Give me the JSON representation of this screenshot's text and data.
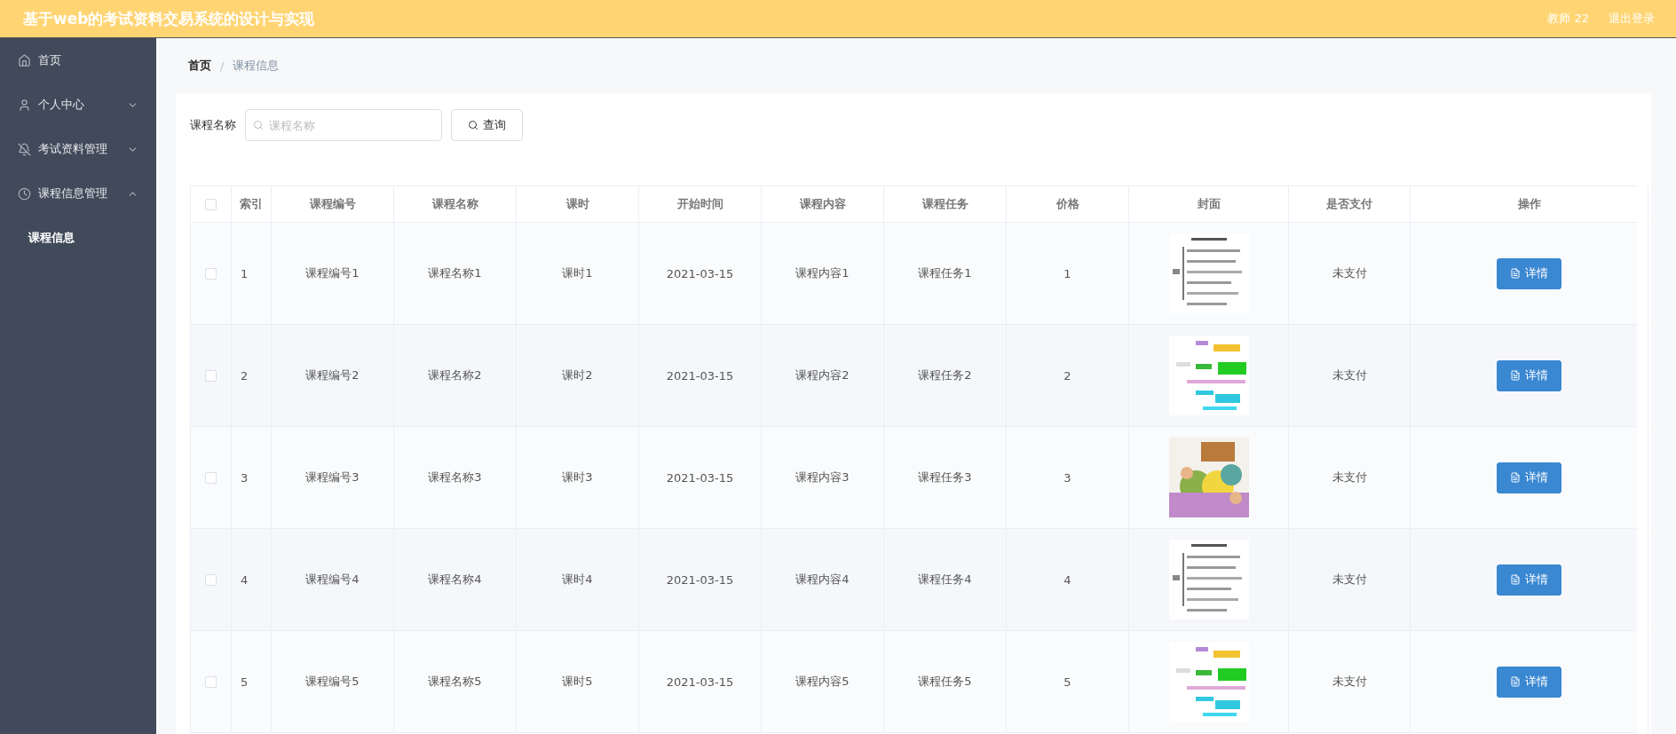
{
  "header": {
    "title": "基于web的考试资料交易系统的设计与实现",
    "user": "教师 22",
    "logout": "退出登录"
  },
  "sidebar": {
    "items": [
      {
        "label": "首页",
        "kind": "home",
        "selected": false
      },
      {
        "label": "个人中心",
        "kind": "user",
        "selected": false,
        "expanded": false
      },
      {
        "label": "考试资料管理",
        "kind": "bell",
        "selected": false,
        "expanded": false
      },
      {
        "label": "课程信息管理",
        "kind": "clock",
        "selected": false,
        "expanded": true,
        "children": [
          {
            "label": "课程信息",
            "selected": true
          }
        ]
      }
    ]
  },
  "breadcrumb": {
    "separator": "/",
    "items": [
      "首页",
      "课程信息"
    ]
  },
  "search": {
    "label": "课程名称",
    "placeholder": "课程名称",
    "button": "查询"
  },
  "table": {
    "header_checked": false,
    "columns": [
      "索引",
      "课程编号",
      "课程名称",
      "课时",
      "开始时间",
      "课程内容",
      "课程任务",
      "价格",
      "封面",
      "是否支付",
      "操作"
    ],
    "rows": [
      {
        "checked": false,
        "cells": [
          "1",
          "课程编号1",
          "课程名称1",
          "课时1",
          "2021-03-15",
          "课程内容1",
          "课程任务1",
          "1"
        ],
        "paid": "未支付",
        "action": "详情"
      },
      {
        "checked": false,
        "cells": [
          "2",
          "课程编号2",
          "课程名称2",
          "课时2",
          "2021-03-15",
          "课程内容2",
          "课程任务2",
          "2"
        ],
        "paid": "未支付",
        "action": "详情"
      },
      {
        "checked": false,
        "cells": [
          "3",
          "课程编号3",
          "课程名称3",
          "课时3",
          "2021-03-15",
          "课程内容3",
          "课程任务3",
          "3"
        ],
        "paid": "未支付",
        "action": "详情"
      },
      {
        "checked": false,
        "cells": [
          "4",
          "课程编号4",
          "课程名称4",
          "课时4",
          "2021-03-15",
          "课程内容4",
          "课程任务4",
          "4"
        ],
        "paid": "未支付",
        "action": "详情"
      },
      {
        "checked": false,
        "cells": [
          "5",
          "课程编号5",
          "课程名称5",
          "课时5",
          "2021-03-15",
          "课程内容5",
          "课程任务5",
          "5"
        ],
        "paid": "未支付",
        "action": "详情"
      }
    ]
  }
}
